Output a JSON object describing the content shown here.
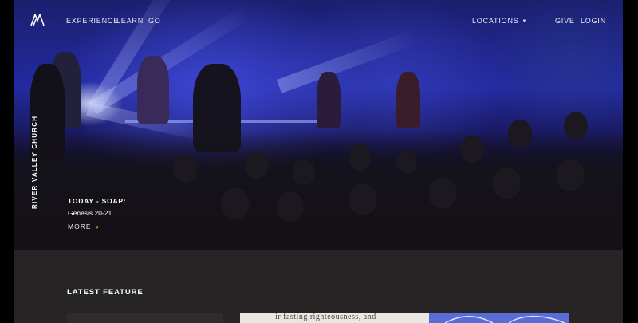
{
  "nav": {
    "links": [
      "EXPERIENCE",
      "LEARN",
      "GO"
    ],
    "locations": "LOCATIONS",
    "give": "GIVE",
    "login": "LOGIN"
  },
  "hero": {
    "church_name": "RIVER VALLEY CHURCH",
    "today_label": "TODAY - SOAP:",
    "today_reference": "Genesis 20-21",
    "more": "MORE",
    "more_arrow": "›"
  },
  "latest": {
    "label": "LATEST FEATURE",
    "feature_text": "ir fasting righteousness, and"
  },
  "colors": {
    "accent": "#f1c84b",
    "page_bg": "#262424",
    "feature_art": "#5a6cd6"
  },
  "icons": {
    "logo": "rvc-logo-icon",
    "locations_caret": "caret-down-icon",
    "more_arrow": "chevron-right-icon"
  }
}
